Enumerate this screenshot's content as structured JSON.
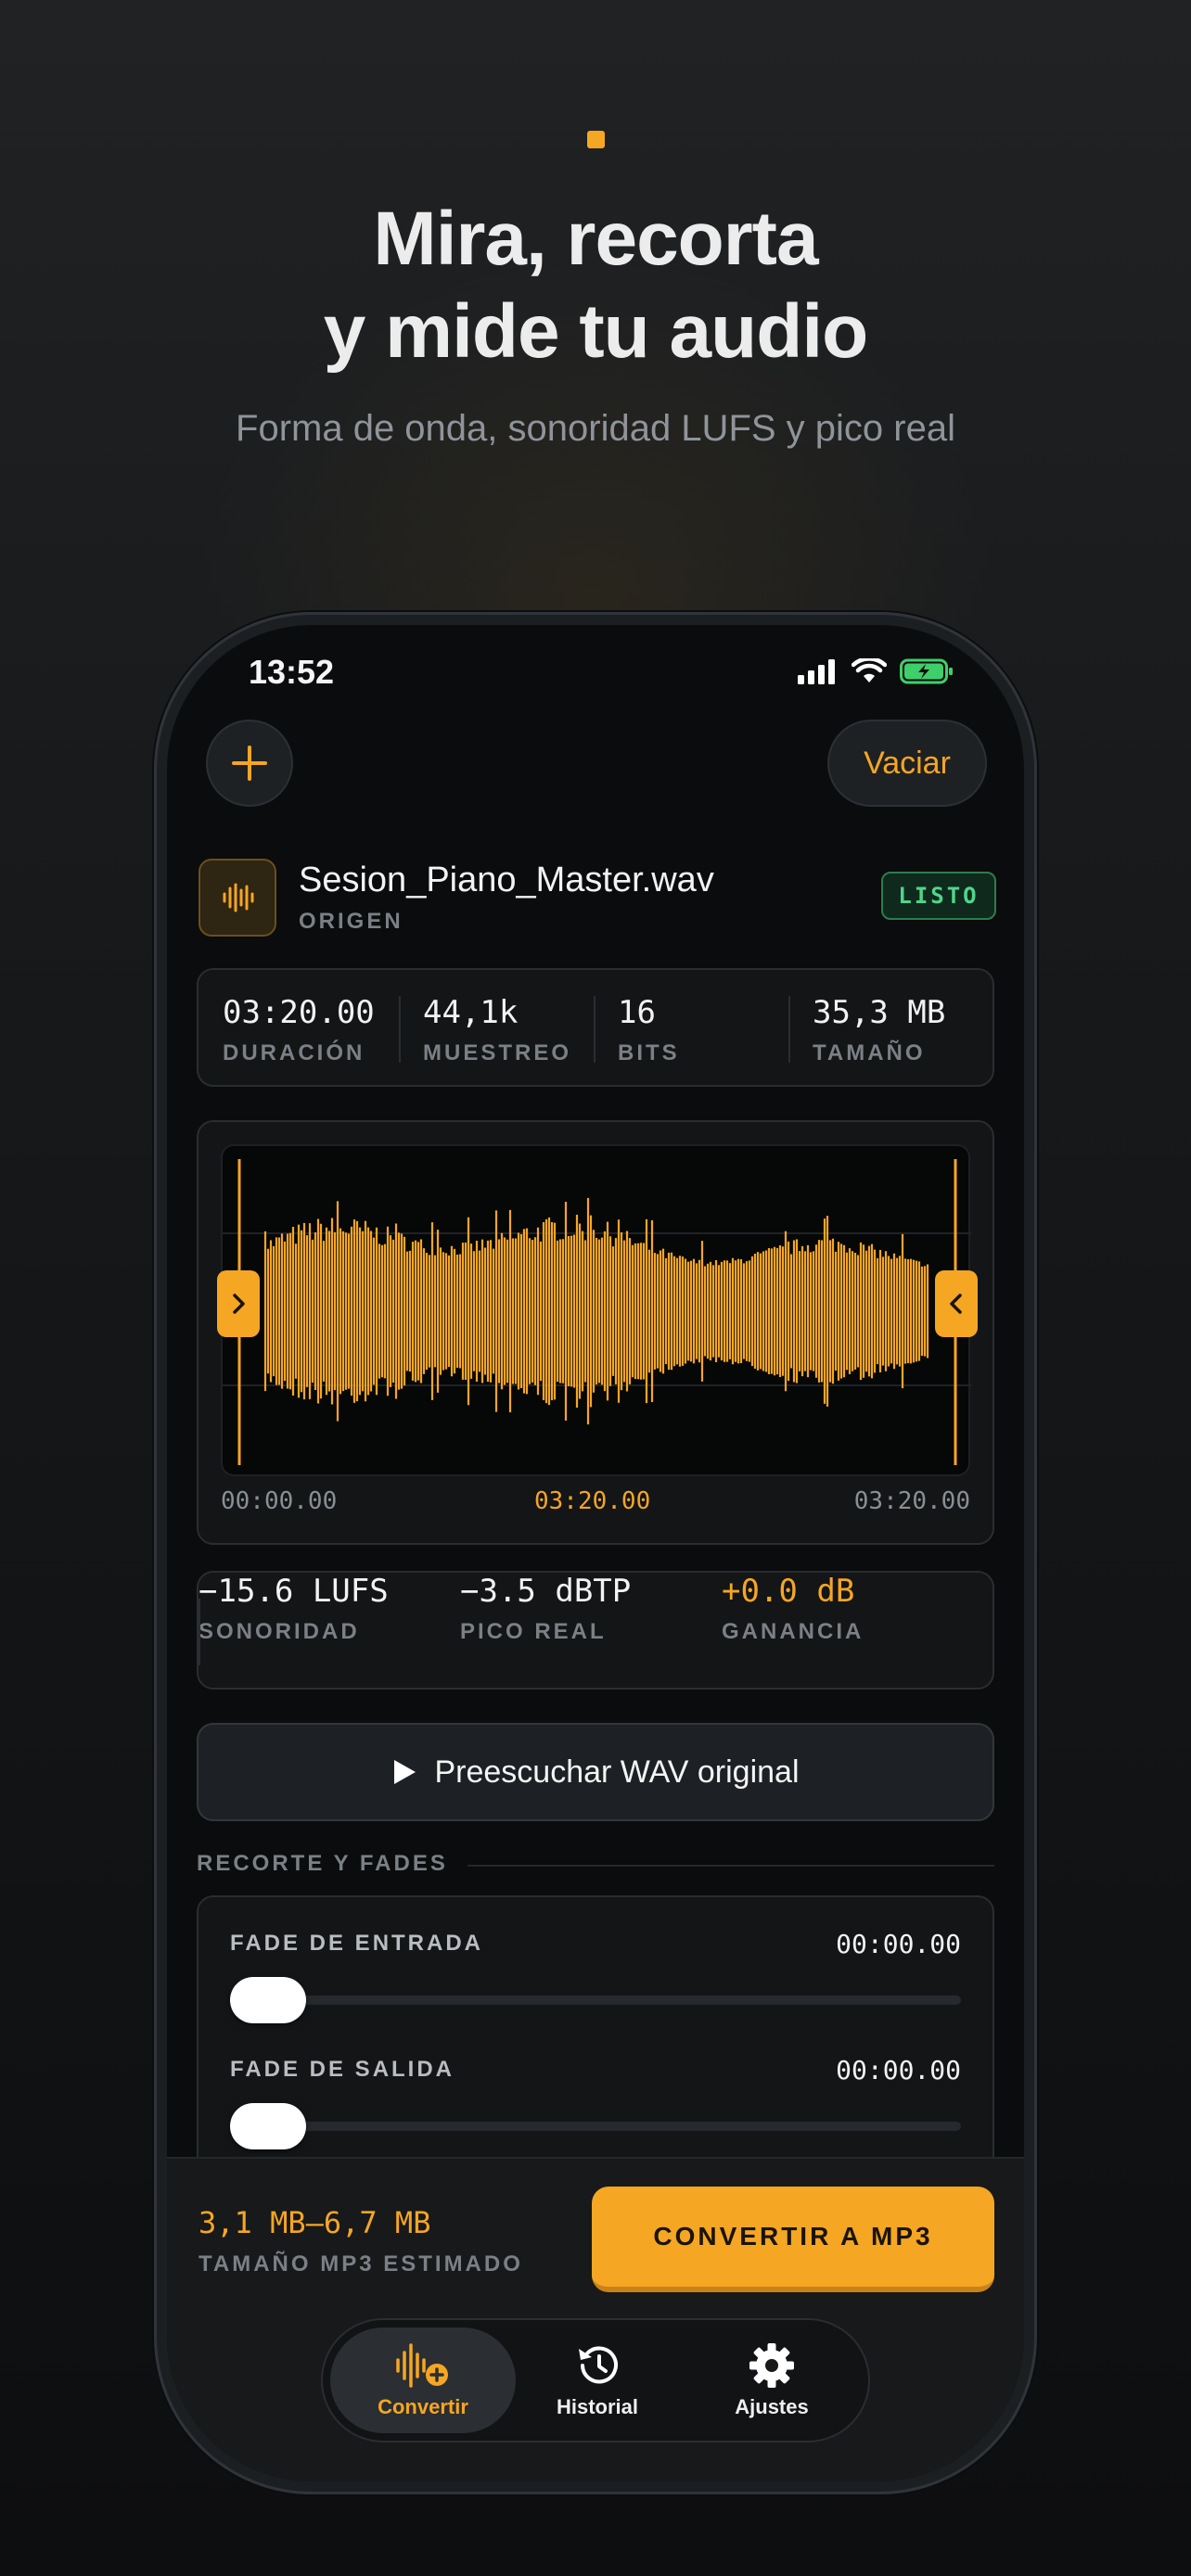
{
  "hero": {
    "headline_line1": "Mira, recorta",
    "headline_line2": "y mide tu audio",
    "subtitle": "Forma de onda, sonoridad LUFS y pico real"
  },
  "status_bar": {
    "time": "13:52"
  },
  "toolbar": {
    "clear_label": "Vaciar"
  },
  "file": {
    "name": "Sesion_Piano_Master.wav",
    "role": "ORIGEN",
    "status": "LISTO"
  },
  "metadata": [
    {
      "value": "03:20.00",
      "label": "DURACIÓN"
    },
    {
      "value": "44,1k",
      "label": "MUESTREO"
    },
    {
      "value": "16",
      "label": "BITS"
    },
    {
      "value": "35,3 MB",
      "label": "TAMAÑO"
    }
  ],
  "waveform": {
    "start_time": "00:00.00",
    "selection_time": "03:20.00",
    "end_time": "03:20.00"
  },
  "loudness": [
    {
      "value": "−15.6 LUFS",
      "label": "SONORIDAD"
    },
    {
      "value": "−3.5 dBTP",
      "label": "PICO REAL"
    },
    {
      "value": "+0.0 dB",
      "label": "GANANCIA"
    }
  ],
  "preview_button": "Preescuchar WAV original",
  "trim_section": {
    "title": "RECORTE Y FADES",
    "fade_in_label": "FADE DE ENTRADA",
    "fade_in_value": "00:00.00",
    "fade_out_label": "FADE DE SALIDA",
    "fade_out_value": "00:00.00"
  },
  "estimate": {
    "value": "3,1 MB–6,7 MB",
    "label": "TAMAÑO MP3 ESTIMADO"
  },
  "convert_button": "CONVERTIR A MP3",
  "tabs": [
    {
      "label": "Convertir",
      "icon": "waveform-add-icon",
      "active": true
    },
    {
      "label": "Historial",
      "icon": "history-icon",
      "active": false
    },
    {
      "label": "Ajustes",
      "icon": "gear-icon",
      "active": false
    }
  ],
  "colors": {
    "accent": "#f5a623",
    "ready_green": "#4fd58a",
    "background": "#0b0c0d"
  }
}
